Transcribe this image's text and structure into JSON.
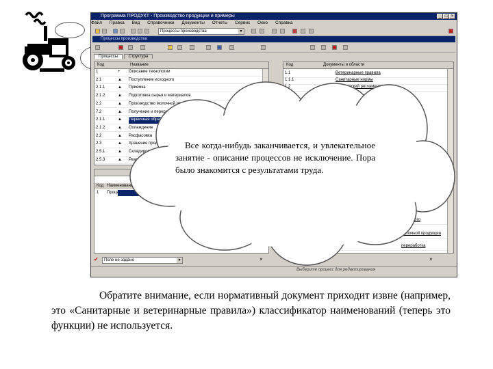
{
  "window": {
    "title": "Программа ПРОДУКТ - Производство продукции и примеры",
    "menu": [
      "Файл",
      "Правка",
      "Вид",
      "Справочники",
      "Документы",
      "Отчеты",
      "Сервис",
      "Окно",
      "Справка"
    ],
    "object_combo": "Процессы производства",
    "inner_tab": "Процессы производства",
    "subtabs": [
      "Процессы",
      "Структура"
    ],
    "bottom_combo": "Поле не задано",
    "status_text": "Выберите процесс для редактирования"
  },
  "left_panel": {
    "headers": [
      "Код",
      "",
      "Название"
    ],
    "rows": [
      {
        "code": "1",
        "mark": "+",
        "name": "Описание технологии"
      },
      {
        "code": "2.1",
        "mark": "▲",
        "name": "Поступление исходного"
      },
      {
        "code": "2.1.1",
        "mark": "▲",
        "name": "Приемка"
      },
      {
        "code": "2.1.2",
        "mark": "▲",
        "name": "Подготовка сырья и материалов"
      },
      {
        "code": "2.2",
        "mark": "▲",
        "name": "Производство молочной продукции"
      },
      {
        "code": "7.2",
        "mark": "▲",
        "name": "Получение и переработка"
      },
      {
        "code": "2.1.1",
        "mark": "▲",
        "name": "Первичная обработка",
        "selected": true
      },
      {
        "code": "2.1.2",
        "mark": "▲",
        "name": "Охлаждение"
      },
      {
        "code": "2.2",
        "mark": "▲",
        "name": "Расфасовка"
      },
      {
        "code": "2.3",
        "mark": "▲",
        "name": "Хранение продукции"
      },
      {
        "code": "2.5.1",
        "mark": "▲",
        "name": "Складирование"
      },
      {
        "code": "2.5.3",
        "mark": "▲",
        "name": "Реализация"
      }
    ],
    "lower_headers": [
      "Код",
      "Наименование"
    ],
    "lower_rows": [
      {
        "code": "1",
        "name": "Процесс"
      }
    ]
  },
  "right_panel": {
    "headers": [
      "Код",
      "Документы и области"
    ],
    "rows": [
      {
        "code": "1.1",
        "name": "Ветеринарные правила"
      },
      {
        "code": "1.1.1",
        "name": "Санитарные нормы"
      },
      {
        "code": "1.2",
        "name": "Технический регламент"
      }
    ],
    "lower_rows": [
      {
        "name": "исходного"
      },
      {
        "name": "молочной продукции"
      },
      {
        "name": "переработка"
      }
    ]
  },
  "cloud_text": "Все когда-нибудь заканчивается, и увлекательное занятие - описание процессов не исключение. Пора было знакомится с результатами труда.",
  "caption": "Обратите внимание, если нормативный документ приходит извне (например, это «Санитарные и ветеринарные правила») классификатор наименований (теперь это функции) не используется."
}
